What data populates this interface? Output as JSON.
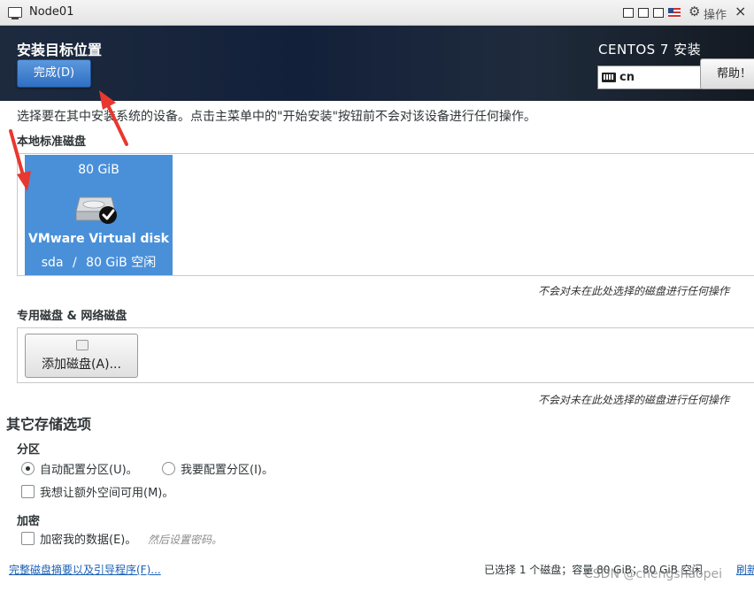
{
  "window": {
    "title": "Node01",
    "ops_label": "操作",
    "close_glyph": "×"
  },
  "header": {
    "page_title": "安装目标位置",
    "done_label": "完成(D)",
    "product": "CENTOS 7 安装",
    "keyboard_layout": "cn",
    "help_label": "帮助！"
  },
  "main": {
    "instruction": "选择要在其中安装系统的设备。点击主菜单中的\"开始安装\"按钮前不会对该设备进行任何操作。",
    "local_disks": {
      "title": "本地标准磁盘",
      "disks": [
        {
          "size": "80 GiB",
          "name": "VMware Virtual disk",
          "device": "sda",
          "separator": "/",
          "free": "80 GiB 空闲",
          "selected": true
        }
      ],
      "note": "不会对未在此处选择的磁盘进行任何操作"
    },
    "special_disks": {
      "title": "专用磁盘 & 网络磁盘",
      "add_label": "添加磁盘(A)...",
      "note": "不会对未在此处选择的磁盘进行任何操作"
    },
    "other_options": {
      "title": "其它存储选项",
      "partition": {
        "title": "分区",
        "auto_label": "自动配置分区(U)。",
        "manual_label": "我要配置分区(I)。",
        "selected": "auto",
        "extra_space_label": "我想让额外空间可用(M)。"
      },
      "encryption": {
        "title": "加密",
        "encrypt_label": "加密我的数据(E)。",
        "hint": "然后设置密码。"
      }
    }
  },
  "footer": {
    "summary_link": "完整磁盘摘要以及引导程序(F)...",
    "status": "已选择 1 个磁盘；容量 80 GiB；80 GiB 空闲",
    "refresh_link": "刷新"
  },
  "watermark": "CSDN @chengshaopei",
  "colors": {
    "accent": "#4a90d9",
    "header_bg": "#1d2a3e",
    "arrow": "#e8382f",
    "link": "#1a5fb4"
  }
}
